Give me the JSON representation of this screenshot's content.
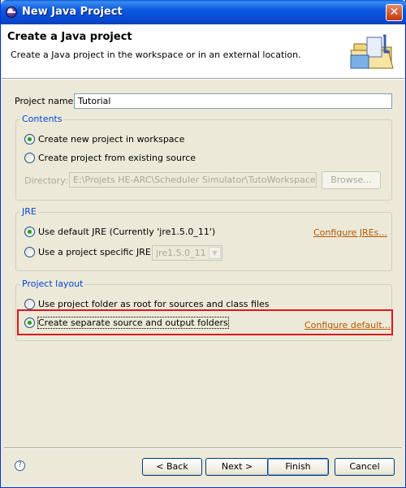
{
  "window": {
    "title": "New Java Project",
    "close_label": "✕"
  },
  "banner": {
    "title": "Create a Java project",
    "description": "Create a Java project in the workspace or in an external location.",
    "icon": "java-project-folder-icon"
  },
  "project_name": {
    "label": "Project name:",
    "value": "Tutorial"
  },
  "contents": {
    "legend": "Contents",
    "option_new": "Create new project in workspace",
    "option_existing": "Create project from existing source",
    "directory_label": "Directory:",
    "directory_value": "E:\\Projets HE-ARC\\Scheduler Simulator\\TutoWorkspace\\Tutor",
    "browse_label": "Browse...",
    "selected": "new"
  },
  "jre": {
    "legend": "JRE",
    "option_default": "Use default JRE (Currently 'jre1.5.0_11')",
    "option_specific": "Use a project specific JRE:",
    "specific_value": "jre1.5.0_11",
    "configure_link": "Configure JREs...",
    "selected": "default"
  },
  "project_layout": {
    "legend": "Project layout",
    "option_root": "Use project folder as root for sources and class files",
    "option_separate": "Create separate source and output folders",
    "configure_link": "Configure default...",
    "selected": "separate"
  },
  "buttons": {
    "back": "< Back",
    "next": "Next >",
    "finish": "Finish",
    "cancel": "Cancel"
  },
  "help": {
    "icon": "help-icon",
    "glyph": "?"
  },
  "colors": {
    "accent": "#0046d5",
    "link": "#b35900",
    "highlight": "#e0141e"
  }
}
